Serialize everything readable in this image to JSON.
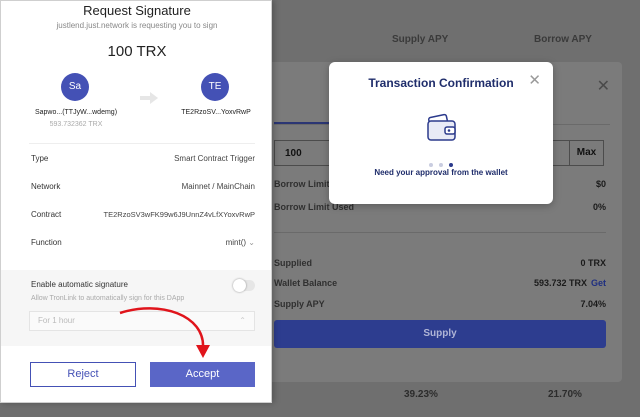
{
  "background": {
    "header_supply_apy": "Supply APY",
    "header_borrow_apy": "Borrow APY",
    "bottom_supply_apy": "39.23%",
    "bottom_borrow_apy": "21.70%"
  },
  "supply_modal": {
    "amount_value": "100",
    "max_label": "Max",
    "rows": [
      {
        "label": "Borrow Limit",
        "value": "$0"
      },
      {
        "label": "Borrow Limit Used",
        "value": "0%"
      },
      {
        "label": "Supplied",
        "value": "0 TRX"
      },
      {
        "label": "Wallet Balance",
        "value": "593.732 TRX",
        "link": "Get"
      },
      {
        "label": "Supply APY",
        "value": "7.04%"
      }
    ],
    "supply_button": "Supply"
  },
  "tx_confirm": {
    "title": "Transaction Confirmation",
    "message": "Need your approval from the wallet"
  },
  "tronlink": {
    "title": "Request Signature",
    "subtitle": "justlend.just.network is requesting you to sign",
    "amount": "100 TRX",
    "from": {
      "initials": "Sa",
      "name": "Sapwo...(TTJyW...wdemg)",
      "balance": "593.732362 TRX"
    },
    "to": {
      "initials": "TE",
      "name": "TE2RzoSV...YoxvRwP"
    },
    "details": [
      {
        "label": "Type",
        "value": "Smart Contract Trigger"
      },
      {
        "label": "Network",
        "value": "Mainnet / MainChain"
      },
      {
        "label": "Contract",
        "value": "TE2RzoSV3wFK99w6J9UnnZ4vLfXYoxvRwP"
      },
      {
        "label": "Function",
        "value": "mint()"
      }
    ],
    "auto_sign_title": "Enable automatic signature",
    "auto_sign_desc": "Allow TronLink to automatically sign for this DApp",
    "period_value": "For 1 hour",
    "reject_label": "Reject",
    "accept_label": "Accept"
  }
}
